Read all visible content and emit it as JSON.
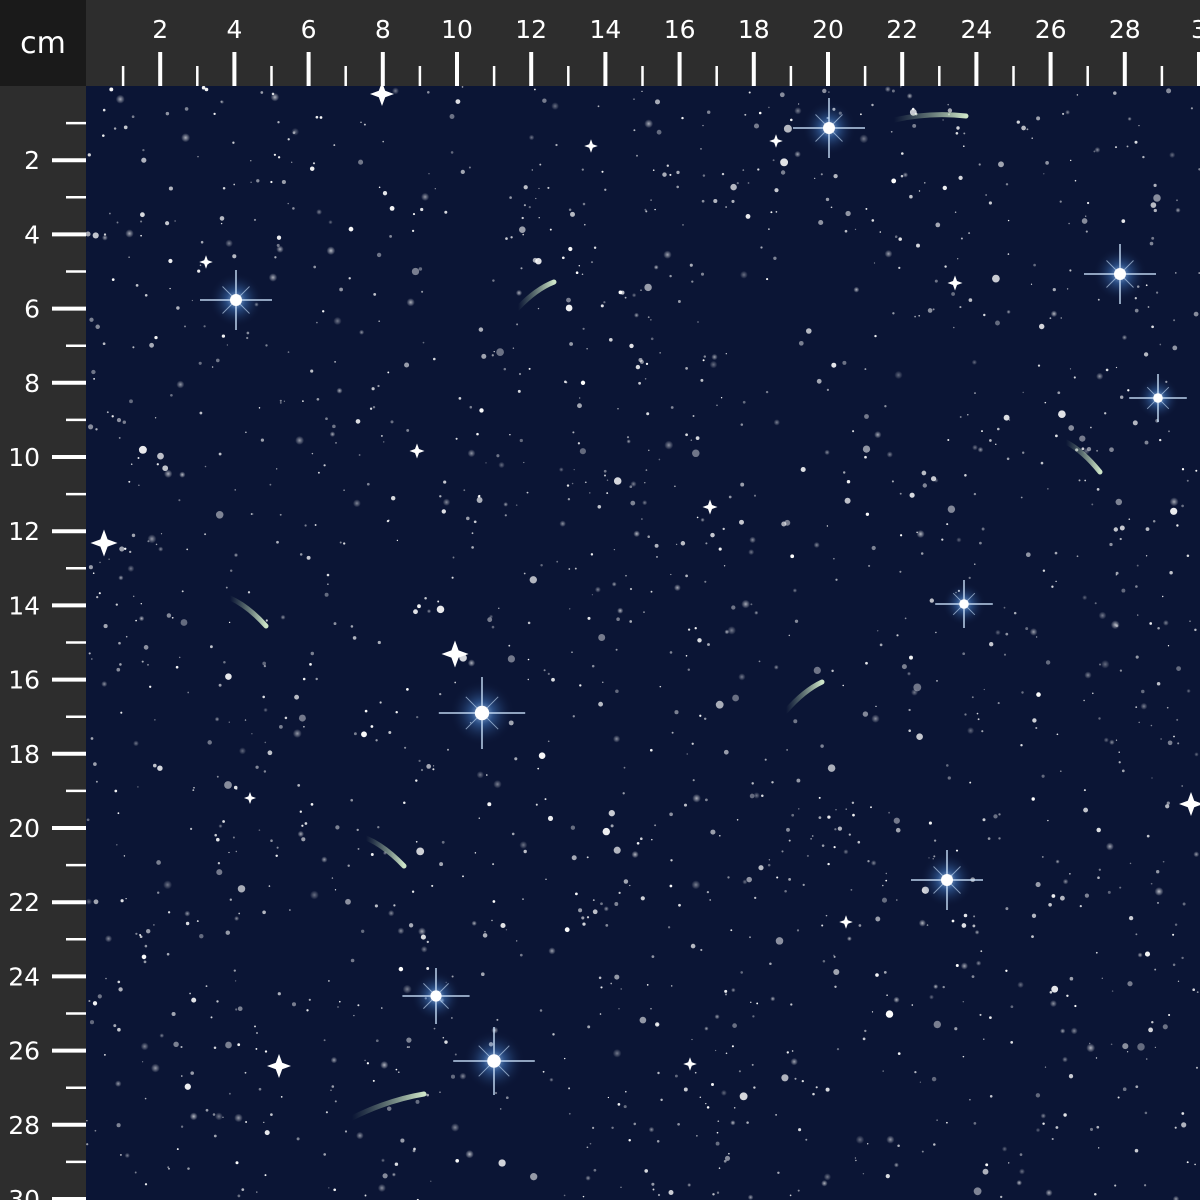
{
  "unit_label": "cm",
  "ruler": {
    "top_labels": [
      "2",
      "4",
      "6",
      "8",
      "10",
      "12",
      "14",
      "16",
      "18",
      "20",
      "22",
      "24",
      "26",
      "28",
      "3"
    ],
    "left_labels": [
      "2",
      "4",
      "6",
      "8",
      "10",
      "12",
      "14",
      "16",
      "18",
      "20",
      "22",
      "24",
      "26",
      "28",
      "30"
    ]
  },
  "fabric": {
    "pattern": "starry-night-sky",
    "background_color": "#0b1535",
    "star_color": "#ffffff",
    "glow_color": "#7fb8ff",
    "comet_color": "#a9c9a4"
  }
}
